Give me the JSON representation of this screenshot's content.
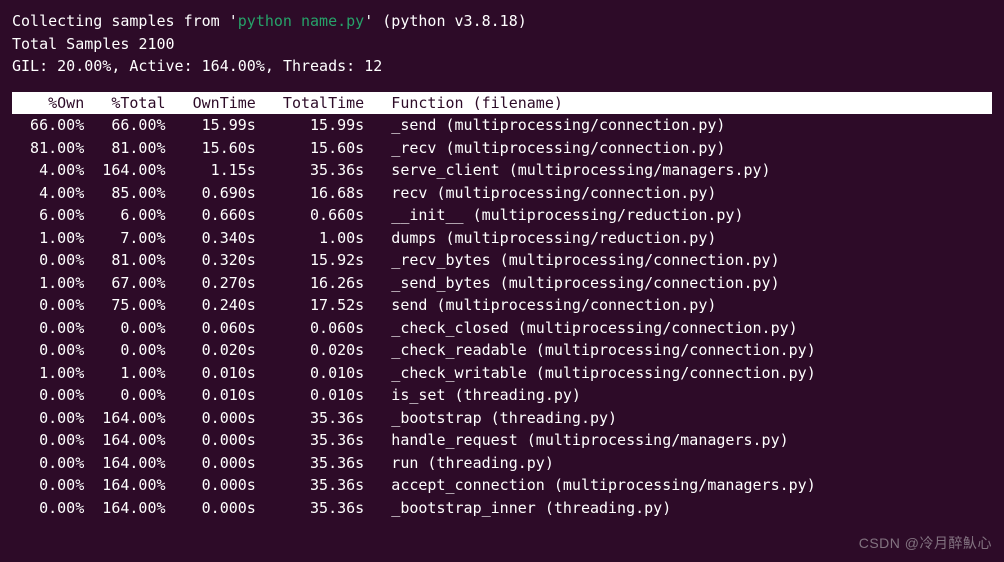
{
  "header": {
    "collecting_prefix": "Collecting samples from '",
    "command": "python name.py",
    "collecting_suffix": "' (python v3.8.18)",
    "total_samples_label": "Total Samples",
    "total_samples_value": "2100",
    "gil_label": "GIL:",
    "gil_value": "20.00%",
    "active_label": "Active:",
    "active_value": "164.00%",
    "threads_label": "Threads:",
    "threads_value": "12"
  },
  "columns": {
    "own_pct": "%Own",
    "total_pct": "%Total",
    "own_time": "OwnTime",
    "total_time": "TotalTime",
    "function": "Function (filename)"
  },
  "rows": [
    {
      "own_pct": "66.00%",
      "total_pct": "66.00%",
      "own_time": "15.99s",
      "total_time": "15.99s",
      "function": "_send (multiprocessing/connection.py)"
    },
    {
      "own_pct": "81.00%",
      "total_pct": "81.00%",
      "own_time": "15.60s",
      "total_time": "15.60s",
      "function": "_recv (multiprocessing/connection.py)"
    },
    {
      "own_pct": "4.00%",
      "total_pct": "164.00%",
      "own_time": "1.15s",
      "total_time": "35.36s",
      "function": "serve_client (multiprocessing/managers.py)"
    },
    {
      "own_pct": "4.00%",
      "total_pct": "85.00%",
      "own_time": "0.690s",
      "total_time": "16.68s",
      "function": "recv (multiprocessing/connection.py)"
    },
    {
      "own_pct": "6.00%",
      "total_pct": "6.00%",
      "own_time": "0.660s",
      "total_time": "0.660s",
      "function": "__init__ (multiprocessing/reduction.py)"
    },
    {
      "own_pct": "1.00%",
      "total_pct": "7.00%",
      "own_time": "0.340s",
      "total_time": "1.00s",
      "function": "dumps (multiprocessing/reduction.py)"
    },
    {
      "own_pct": "0.00%",
      "total_pct": "81.00%",
      "own_time": "0.320s",
      "total_time": "15.92s",
      "function": "_recv_bytes (multiprocessing/connection.py)"
    },
    {
      "own_pct": "1.00%",
      "total_pct": "67.00%",
      "own_time": "0.270s",
      "total_time": "16.26s",
      "function": "_send_bytes (multiprocessing/connection.py)"
    },
    {
      "own_pct": "0.00%",
      "total_pct": "75.00%",
      "own_time": "0.240s",
      "total_time": "17.52s",
      "function": "send (multiprocessing/connection.py)"
    },
    {
      "own_pct": "0.00%",
      "total_pct": "0.00%",
      "own_time": "0.060s",
      "total_time": "0.060s",
      "function": "_check_closed (multiprocessing/connection.py)"
    },
    {
      "own_pct": "0.00%",
      "total_pct": "0.00%",
      "own_time": "0.020s",
      "total_time": "0.020s",
      "function": "_check_readable (multiprocessing/connection.py)"
    },
    {
      "own_pct": "1.00%",
      "total_pct": "1.00%",
      "own_time": "0.010s",
      "total_time": "0.010s",
      "function": "_check_writable (multiprocessing/connection.py)"
    },
    {
      "own_pct": "0.00%",
      "total_pct": "0.00%",
      "own_time": "0.010s",
      "total_time": "0.010s",
      "function": "is_set (threading.py)"
    },
    {
      "own_pct": "0.00%",
      "total_pct": "164.00%",
      "own_time": "0.000s",
      "total_time": "35.36s",
      "function": "_bootstrap (threading.py)"
    },
    {
      "own_pct": "0.00%",
      "total_pct": "164.00%",
      "own_time": "0.000s",
      "total_time": "35.36s",
      "function": "handle_request (multiprocessing/managers.py)"
    },
    {
      "own_pct": "0.00%",
      "total_pct": "164.00%",
      "own_time": "0.000s",
      "total_time": "35.36s",
      "function": "run (threading.py)"
    },
    {
      "own_pct": "0.00%",
      "total_pct": "164.00%",
      "own_time": "0.000s",
      "total_time": "35.36s",
      "function": "accept_connection (multiprocessing/managers.py)"
    },
    {
      "own_pct": "0.00%",
      "total_pct": "164.00%",
      "own_time": "0.000s",
      "total_time": "35.36s",
      "function": "_bootstrap_inner (threading.py)"
    }
  ],
  "watermark": "CSDN @冷月醉魜心"
}
